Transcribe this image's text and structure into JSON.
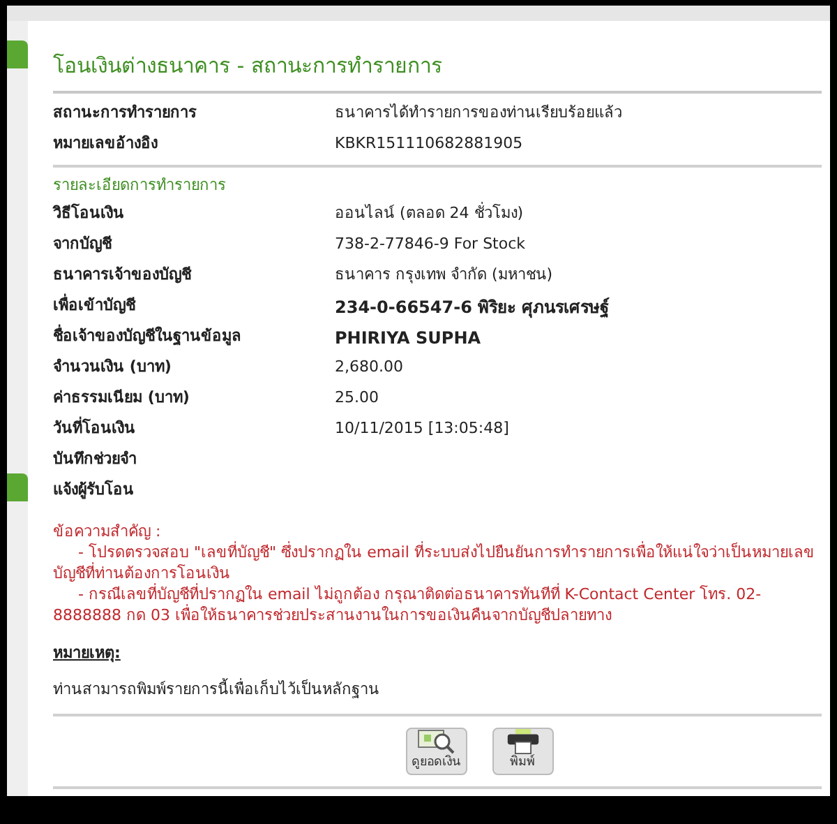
{
  "title": "โอนเงินต่างธนาคาร - สถานะการทำรายการ",
  "summary": [
    {
      "label": "สถานะการทำรายการ",
      "value": "ธนาคารได้ทำรายการของท่านเรียบร้อยแล้ว",
      "bold": false
    },
    {
      "label": "หมายเลขอ้างอิง",
      "value": "KBKR151110682881905",
      "bold": false
    }
  ],
  "details_heading": "รายละเอียดการทำรายการ",
  "details": [
    {
      "label": "วิธีโอนเงิน",
      "value": "ออนไลน์ (ตลอด 24 ชั่วโมง)",
      "bold": false
    },
    {
      "label": "จากบัญชี",
      "value": "738-2-77846-9 For Stock",
      "bold": false
    },
    {
      "label": "ธนาคารเจ้าของบัญชี",
      "value": "ธนาคาร กรุงเทพ จำกัด (มหาชน)",
      "bold": false
    },
    {
      "label": "เพื่อเข้าบัญชี",
      "value": "234-0-66547-6 พิริยะ ศุภนรเศรษฐ์",
      "bold": true
    },
    {
      "label": "ชื่อเจ้าของบัญชีในฐานข้อมูล",
      "value": "PHIRIYA SUPHA",
      "bold": true
    },
    {
      "label": "จำนวนเงิน (บาท)",
      "value": "2,680.00",
      "bold": false
    },
    {
      "label": "ค่าธรรมเนียม (บาท)",
      "value": "25.00",
      "bold": false
    },
    {
      "label": "วันที่โอนเงิน",
      "value": "10/11/2015 [13:05:48]",
      "bold": false
    },
    {
      "label": "บันทึกช่วยจำ"
    },
    {
      "label": "แจ้งผู้รับโอน"
    }
  ],
  "important": {
    "heading": "ข้อความสำคัญ :",
    "items": [
      "- โปรดตรวจสอบ \"เลขที่บัญชี\" ซึ่งปรากฏใน email ที่ระบบส่งไปยืนยันการทำรายการเพื่อให้แน่ใจว่าเป็นหมายเลขบัญชีที่ท่านต้องการโอนเงิน",
      "- กรณีเลขที่บัญชีที่ปรากฏใน email ไม่ถูกต้อง กรุณาติดต่อธนาคารทันทีที่ K-Contact Center โทร. 02-8888888 กด 03 เพื่อให้ธนาคารช่วยประสานงานในการขอเงินคืนจากบัญชีปลายทาง"
    ]
  },
  "note": {
    "heading": "หมายเหตุ:",
    "text": "ท่านสามารถพิมพ์รายการนี้เพื่อเก็บไว้เป็นหลักฐาน"
  },
  "buttons": [
    {
      "kind": "balance",
      "label": "ดูยอดเงิน"
    },
    {
      "kind": "print",
      "label": "พิมพ์"
    }
  ]
}
